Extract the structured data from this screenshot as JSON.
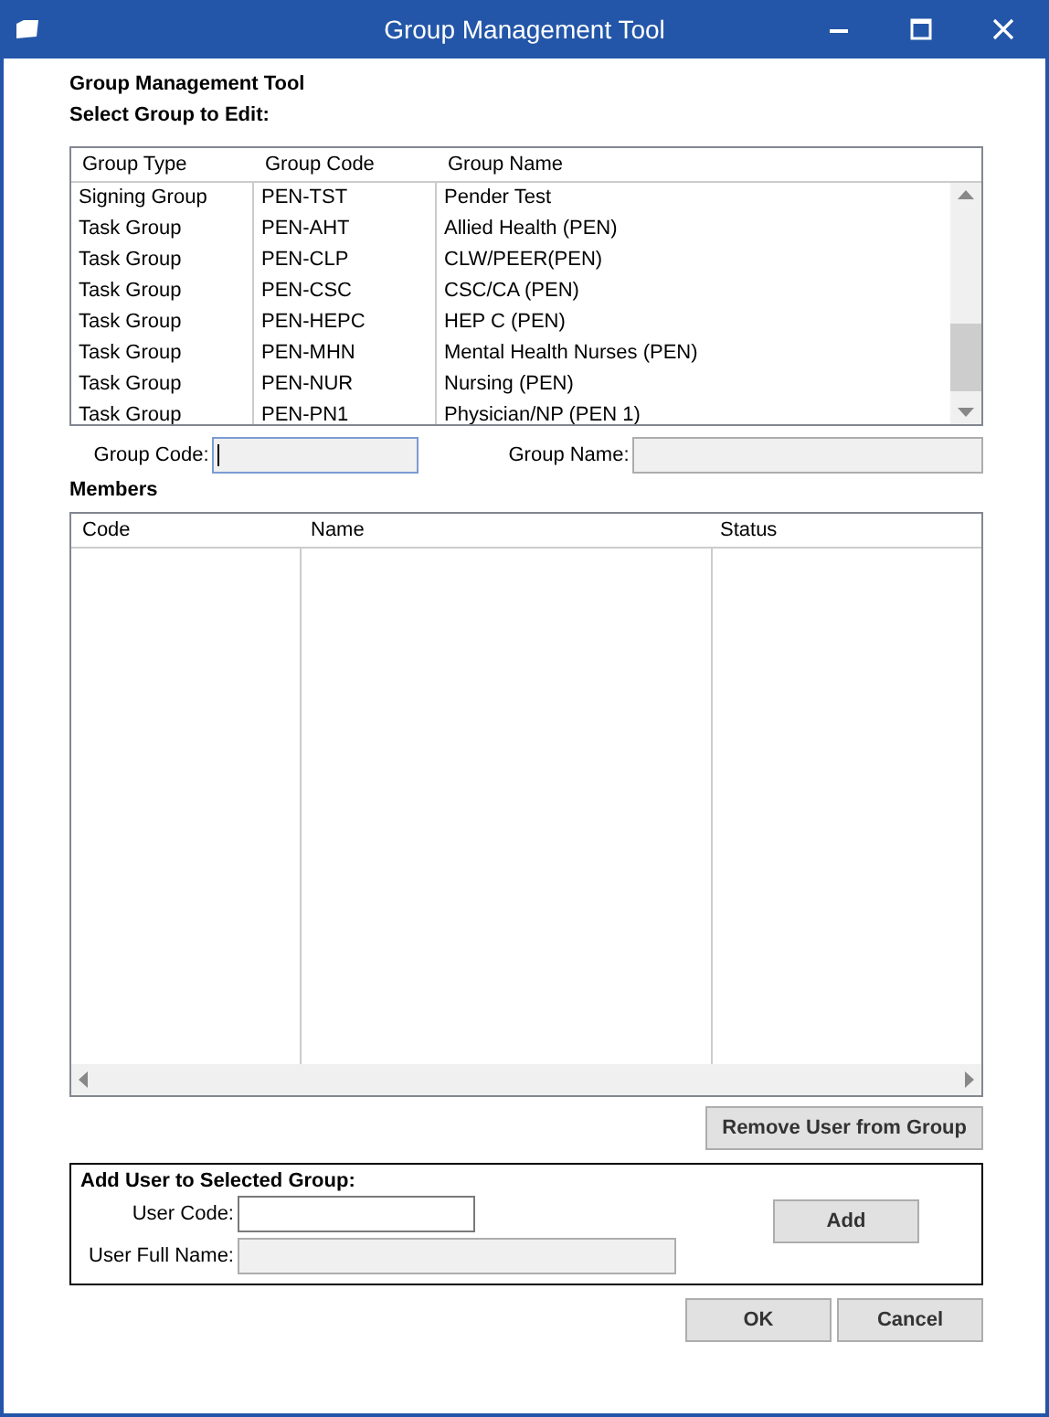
{
  "window": {
    "title": "Group Management Tool"
  },
  "heading": "Group Management Tool",
  "select_label": "Select Group to Edit:",
  "groups_table": {
    "columns": [
      "Group Type",
      "Group Code",
      "Group Name"
    ],
    "rows": [
      {
        "cells": [
          "Signing Group",
          "PEN-TST",
          "Pender Test"
        ]
      },
      {
        "cells": [
          "Task Group",
          "PEN-AHT",
          "Allied Health (PEN)"
        ]
      },
      {
        "cells": [
          "Task Group",
          "PEN-CLP",
          "CLW/PEER(PEN)"
        ]
      },
      {
        "cells": [
          "Task Group",
          "PEN-CSC",
          "CSC/CA (PEN)"
        ]
      },
      {
        "cells": [
          "Task Group",
          "PEN-HEPC",
          "HEP C (PEN)"
        ]
      },
      {
        "cells": [
          "Task Group",
          "PEN-MHN",
          "Mental Health Nurses (PEN)"
        ]
      },
      {
        "cells": [
          "Task Group",
          "PEN-NUR",
          "Nursing (PEN)"
        ]
      },
      {
        "cells": [
          "Task Group",
          "PEN-PN1",
          "Physician/NP (PEN 1)"
        ]
      }
    ]
  },
  "group_code": {
    "label": "Group Code:",
    "focused": true
  },
  "group_name": {
    "label": "Group Name:"
  },
  "members_label": "Members",
  "members_table": {
    "columns": [
      "Code",
      "Name",
      "Status"
    ]
  },
  "remove_button": "Remove User from Group",
  "add_section": {
    "title": "Add User to Selected Group:",
    "user_code": {
      "label": "User Code:",
      "disabled": false
    },
    "user_full_name": {
      "label": "User Full Name:",
      "disabled": true
    },
    "add_button": "Add"
  },
  "buttons": [
    "OK",
    "Cancel"
  ]
}
